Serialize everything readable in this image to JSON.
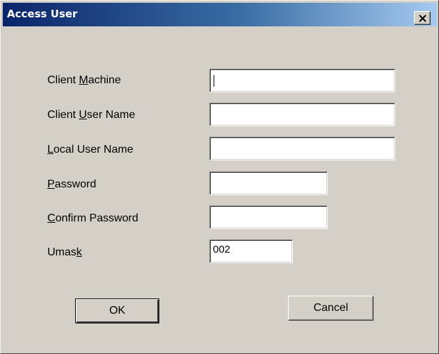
{
  "window": {
    "title": "Access User",
    "close_glyph": "×"
  },
  "form": {
    "fields": [
      {
        "label_pre": "Client ",
        "label_key": "M",
        "label_post": "achine",
        "value": ""
      },
      {
        "label_pre": "Client ",
        "label_key": "U",
        "label_post": "ser Name",
        "value": ""
      },
      {
        "label_pre": "",
        "label_key": "L",
        "label_post": "ocal User Name",
        "value": ""
      },
      {
        "label_pre": "",
        "label_key": "P",
        "label_post": "assword",
        "value": ""
      },
      {
        "label_pre": "",
        "label_key": "C",
        "label_post": "onfirm Password",
        "value": ""
      },
      {
        "label_pre": "Umas",
        "label_key": "k",
        "label_post": "",
        "value": "002"
      }
    ]
  },
  "buttons": {
    "ok_label": "OK",
    "cancel_label": "Cancel"
  }
}
